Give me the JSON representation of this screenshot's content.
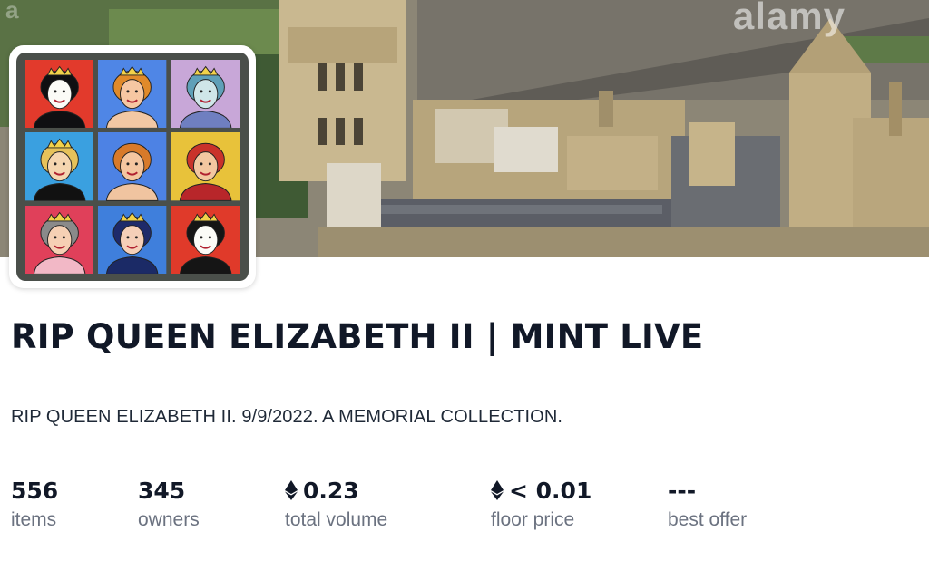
{
  "banner": {
    "watermark": "alamy",
    "corner_mark": "a"
  },
  "collection": {
    "title": "RIP QUEEN ELIZABETH II | MINT LIVE",
    "description": "RIP QUEEN ELIZABETH II. 9/9/2022. A MEMORIAL COLLECTION.",
    "avatar_tiles": [
      {
        "bg": "#e23a2c",
        "hair": "#0f0f12",
        "face": "#fbfbf7",
        "top": "#0f0f12",
        "crown": true
      },
      {
        "bg": "#4f86e6",
        "hair": "#e08a2a",
        "face": "#f6c7a2",
        "top": "#f2c8a4",
        "crown": true
      },
      {
        "bg": "#c8a7d8",
        "hair": "#5fa0b8",
        "face": "#cfe6e8",
        "top": "#6f7fc0",
        "crown": true
      },
      {
        "bg": "#3aa0e0",
        "hair": "#e6c25a",
        "face": "#f5d6b0",
        "top": "#111111",
        "crown": true
      },
      {
        "bg": "#4d82e4",
        "hair": "#d87a2a",
        "face": "#f4c6a0",
        "top": "#f0c4a0",
        "crown": false
      },
      {
        "bg": "#e8c23a",
        "hair": "#c9322a",
        "face": "#f3c7a0",
        "top": "#b8262a",
        "crown": false
      },
      {
        "bg": "#e0405a",
        "hair": "#8a8a8a",
        "face": "#f6d0b4",
        "top": "#f2b8c6",
        "crown": true
      },
      {
        "bg": "#3f7fdc",
        "hair": "#1e2a6a",
        "face": "#f5cfb8",
        "top": "#1b2a66",
        "crown": true
      },
      {
        "bg": "#e03a2a",
        "hair": "#151515",
        "face": "#fbfbf7",
        "top": "#151515",
        "crown": true
      }
    ]
  },
  "stats": [
    {
      "value": "556",
      "label": "items",
      "eth": false
    },
    {
      "value": "345",
      "label": "owners",
      "eth": false
    },
    {
      "value": "0.23",
      "label": "total volume",
      "eth": true
    },
    {
      "value": "< 0.01",
      "label": "floor price",
      "eth": true
    },
    {
      "value": "---",
      "label": "best offer",
      "eth": false
    }
  ],
  "icons": {
    "currency": "ethereum-icon"
  },
  "colors": {
    "text_primary": "#111827",
    "text_secondary": "#6b7280"
  }
}
